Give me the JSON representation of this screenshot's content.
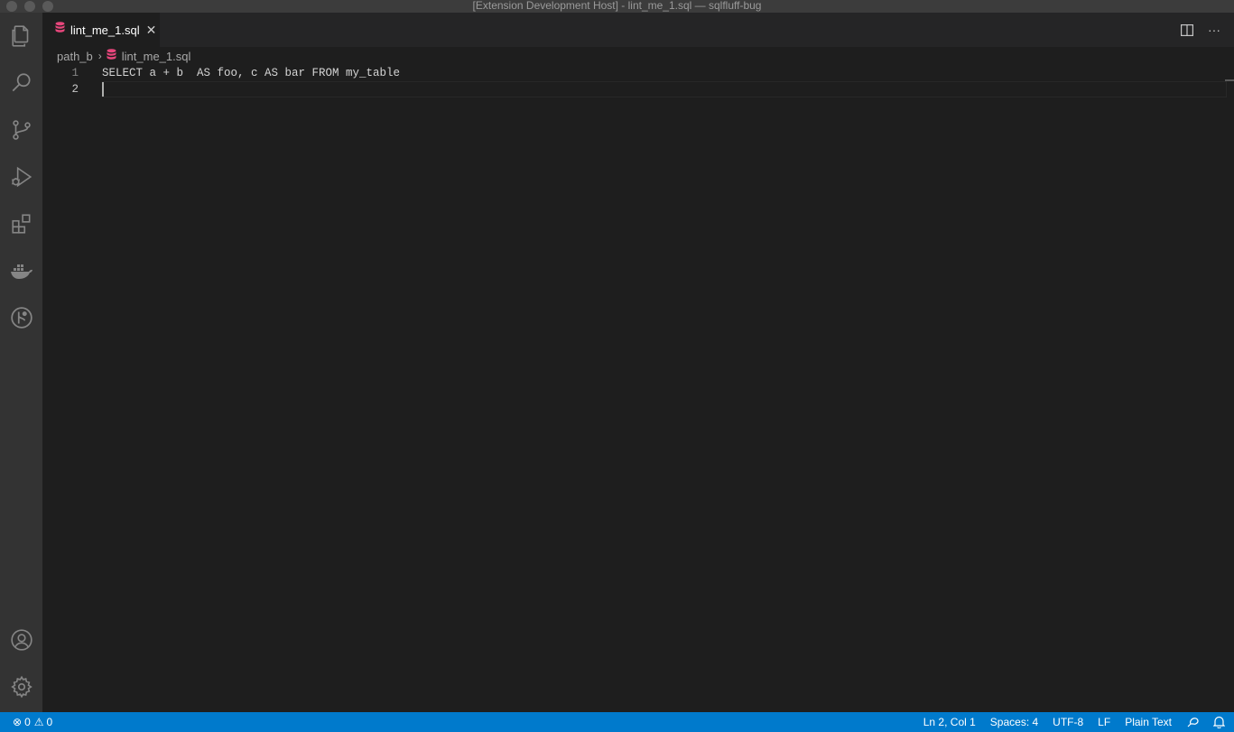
{
  "window": {
    "title": "[Extension Development Host] - lint_me_1.sql — sqlfluff-bug"
  },
  "activity_bar": {
    "items": [
      {
        "name": "explorer-icon"
      },
      {
        "name": "search-icon"
      },
      {
        "name": "source-control-icon"
      },
      {
        "name": "run-debug-icon"
      },
      {
        "name": "extensions-icon"
      },
      {
        "name": "docker-icon"
      },
      {
        "name": "git-graph-icon"
      }
    ],
    "bottom_items": [
      {
        "name": "accounts-icon"
      },
      {
        "name": "settings-gear-icon"
      }
    ]
  },
  "tabs": [
    {
      "label": "lint_me_1.sql",
      "icon": "database-icon",
      "active": true,
      "close_glyph": "✕"
    }
  ],
  "editor_actions": {
    "split_glyph": "◫",
    "more_glyph": "···"
  },
  "breadcrumb": {
    "folder": "path_b",
    "separator": "›",
    "file": "lint_me_1.sql"
  },
  "editor": {
    "lines": [
      {
        "number": "1",
        "code": "SELECT a + b  AS foo, c AS bar FROM my_table"
      },
      {
        "number": "2",
        "code": ""
      }
    ],
    "active_line": 2
  },
  "status_bar": {
    "errors": "0",
    "warnings": "0",
    "error_glyph": "⊗",
    "warning_glyph": "⚠",
    "position": "Ln 2, Col 1",
    "indentation": "Spaces: 4",
    "encoding": "UTF-8",
    "eol": "LF",
    "language": "Plain Text",
    "bell_glyph": "🔔"
  },
  "colors": {
    "status_bar": "#007acc",
    "activity_bar": "#333333",
    "editor_bg": "#1e1e1e",
    "sql_icon": "#e8467c"
  }
}
